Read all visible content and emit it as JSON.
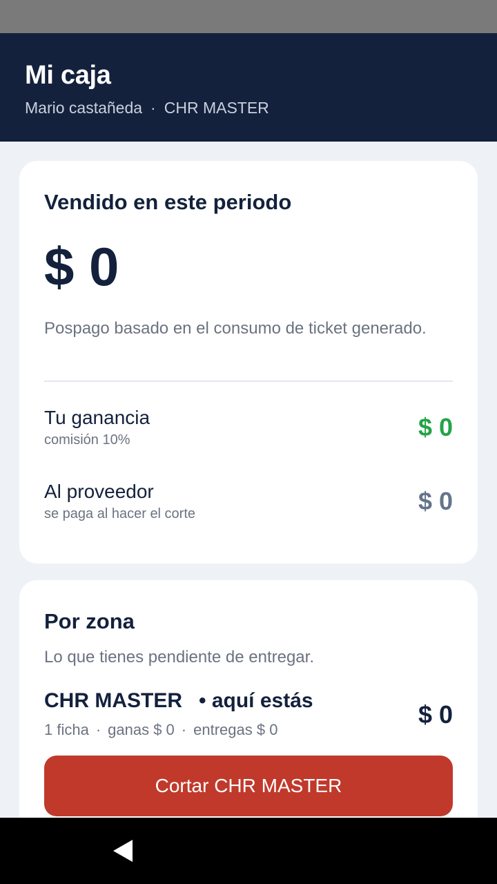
{
  "header": {
    "title": "Mi caja",
    "user": "Mario castañeda",
    "separator": "·",
    "store": "CHR MASTER"
  },
  "period_card": {
    "title": "Vendido en este periodo",
    "amount": "$ 0",
    "note": "Pospago basado en el consumo de ticket generado.",
    "gain": {
      "label": "Tu ganancia",
      "sub": "comisión 10%",
      "amount": "$ 0"
    },
    "provider": {
      "label": "Al proveedor",
      "sub": "se paga al hacer el corte",
      "amount": "$ 0"
    }
  },
  "zone_card": {
    "title": "Por zona",
    "note": "Lo que tienes pendiente de entregar.",
    "zone": {
      "name": "CHR MASTER",
      "here_badge": "• aquí estás",
      "meta": [
        "1 ficha",
        "ganas $ 0",
        "entregas $ 0"
      ],
      "meta_separator": "·",
      "amount": "$ 0",
      "button_label": "Cortar CHR MASTER"
    }
  },
  "colors": {
    "header_bg": "#13213c",
    "gain_green": "#22a447",
    "cut_button_red": "#c0392b"
  },
  "nav": {
    "back_icon": "back-triangle-icon"
  }
}
